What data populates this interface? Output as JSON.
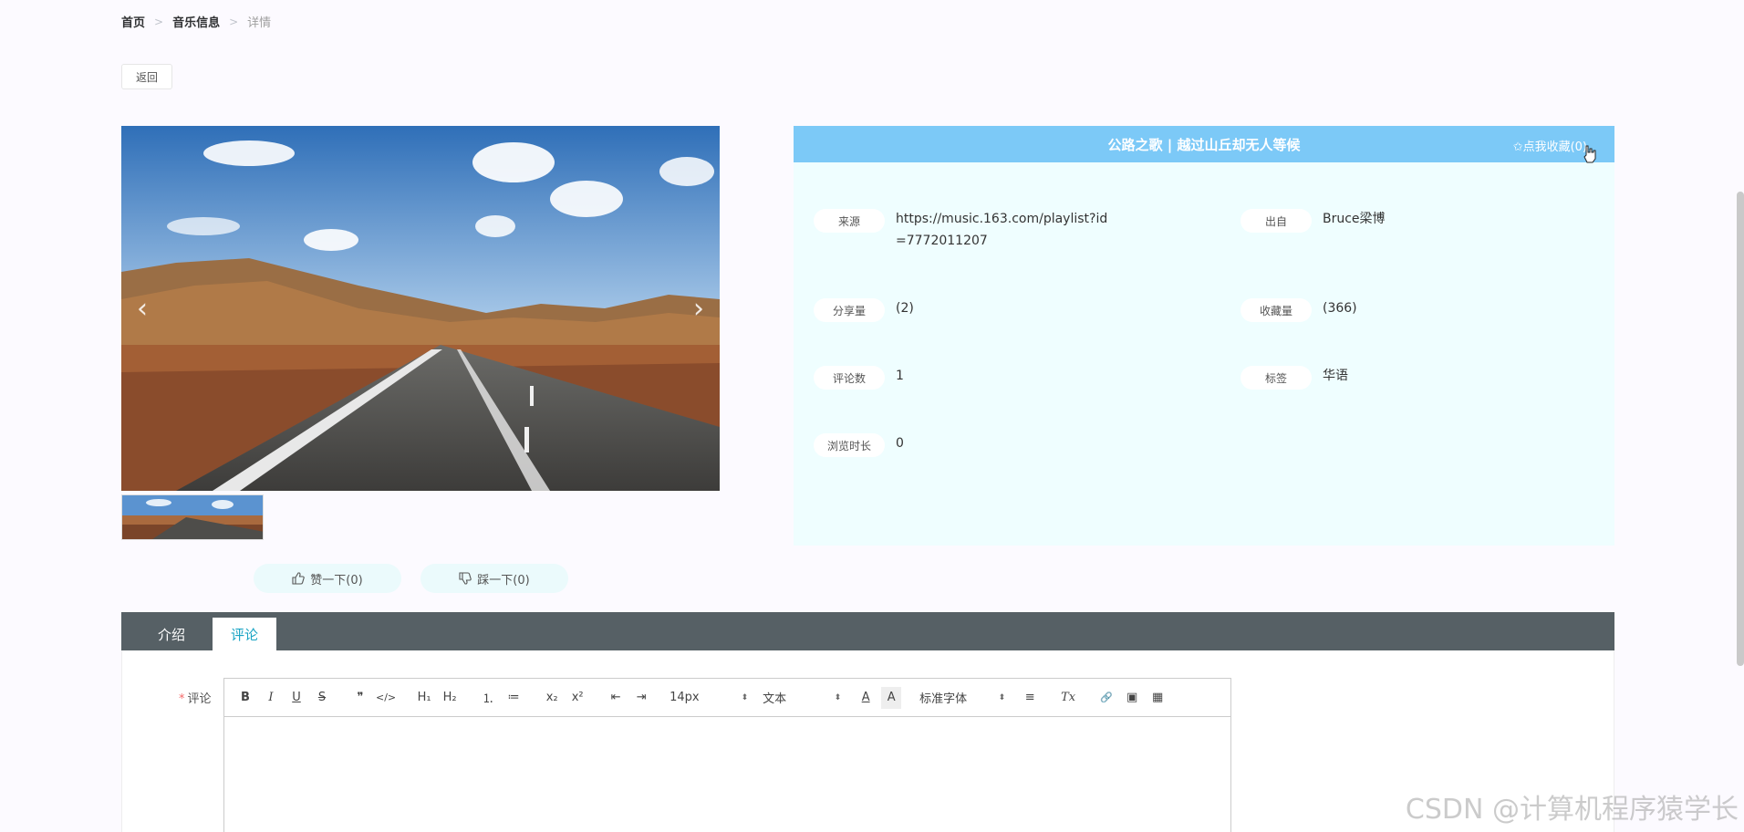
{
  "breadcrumb": {
    "home": "首页",
    "section": "音乐信息",
    "current": "详情",
    "separator": ">"
  },
  "back_label": "返回",
  "gallery": {
    "prev_icon": "chevron-left-icon",
    "next_icon": "chevron-right-icon"
  },
  "detail": {
    "title": "公路之歌 | 越过山丘却无人等候",
    "collect_label": "✩点我收藏(0)",
    "fields": {
      "source_label": "来源",
      "source_value": "https://music.163.com/playlist?id=7772011207",
      "from_label": "出自",
      "from_value": "Bruce梁博",
      "share_label": "分享量",
      "share_value": "(2)",
      "favorite_label": "收藏量",
      "favorite_value": "(366)",
      "comment_label": "评论数",
      "comment_value": "1",
      "tag_label": "标签",
      "tag_value": "华语",
      "view_label": "浏览时长",
      "view_value": "0"
    }
  },
  "votes": {
    "like_label": "赞一下(0)",
    "dislike_label": "踩一下(0)"
  },
  "tabs": [
    {
      "label": "介绍"
    },
    {
      "label": "评论"
    }
  ],
  "comment_form": {
    "required_mark": "*",
    "label": "评论",
    "size_select": "14px",
    "header_select": "文本",
    "font_select": "标准字体"
  },
  "toolbar": {
    "bold": "B",
    "italic": "I",
    "underline": "U",
    "strike": "S",
    "quote": "❞",
    "code": "</>",
    "h1": "H₁",
    "h2": "H₂",
    "ordered": "⒈",
    "bullet": "≔",
    "sub": "x₂",
    "sup": "x²",
    "outdent": "⇤",
    "indent": "⇥",
    "color": "A",
    "bg": "A",
    "align": "≡",
    "clean": "Tx",
    "link": "🔗",
    "image": "▣",
    "video": "▦"
  },
  "watermark": "CSDN @计算机程序猿学长",
  "colors": {
    "header_blue": "#7cc9f7",
    "panel_bg": "#effeff",
    "tab_bar": "#566065",
    "tab_active": "#1aa4c4"
  }
}
